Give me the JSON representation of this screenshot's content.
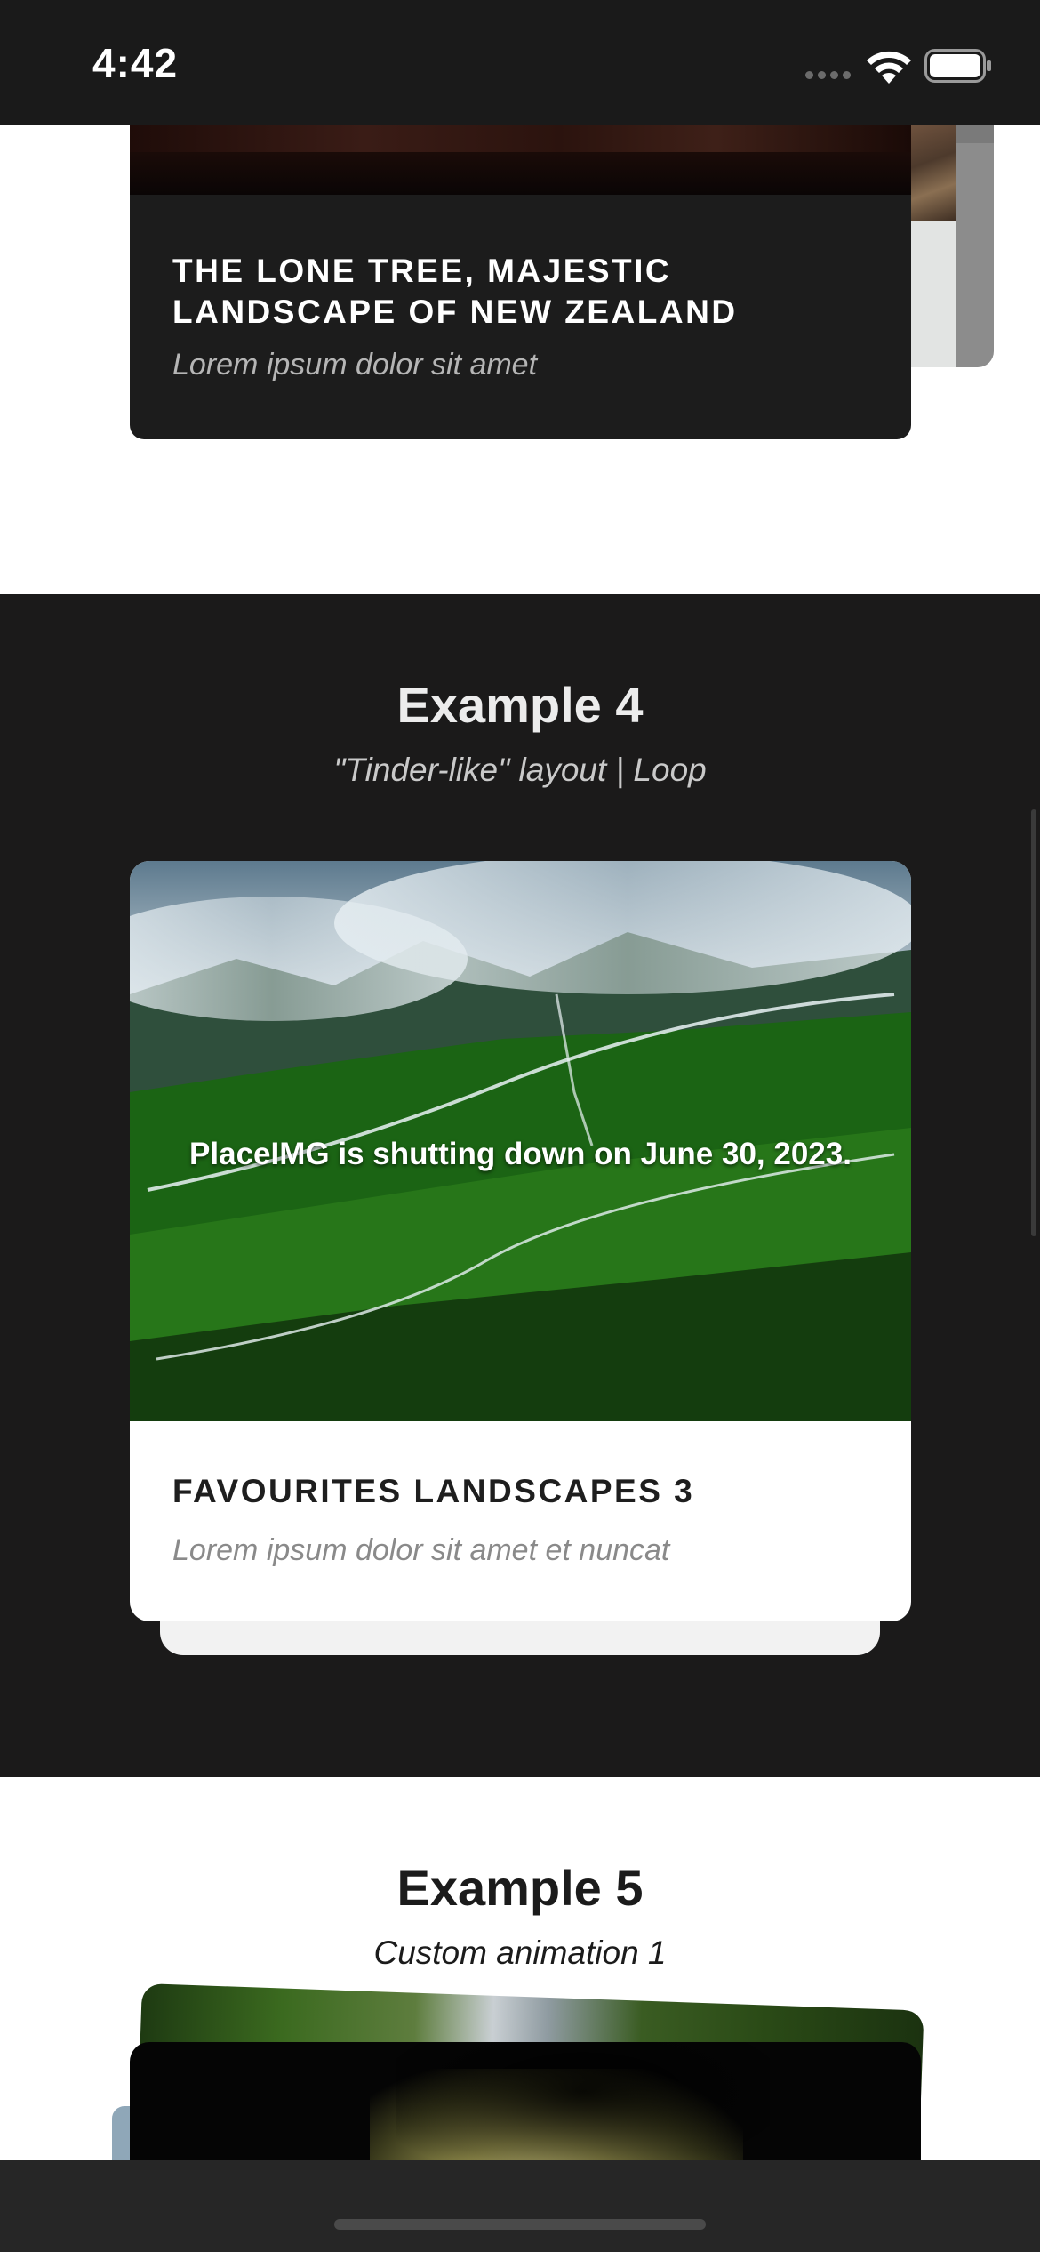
{
  "status_bar": {
    "time": "4:42"
  },
  "section_3": {
    "card": {
      "title": "THE LONE TREE, MAJESTIC LANDSCAPE OF NEW ZEALAND",
      "subtitle": "Lorem ipsum dolor sit amet"
    }
  },
  "section_4": {
    "title": "Example 4",
    "subtitle": "\"Tinder-like\" layout | Loop",
    "card": {
      "image_text": "PlaceIMG is shutting down on June 30, 2023.",
      "title": "FAVOURITES LANDSCAPES 3",
      "subtitle": "Lorem ipsum dolor sit amet et nuncat"
    }
  },
  "section_5": {
    "title": "Example 5",
    "subtitle": "Custom animation 1"
  },
  "icons": {
    "wifi": "wifi-icon",
    "battery": "battery-icon",
    "signal": "cellular-signal-icon"
  },
  "colors": {
    "dark_background": "#1b1a1a",
    "light_background": "#ffffff",
    "card_dark": "#1c1c1c"
  }
}
